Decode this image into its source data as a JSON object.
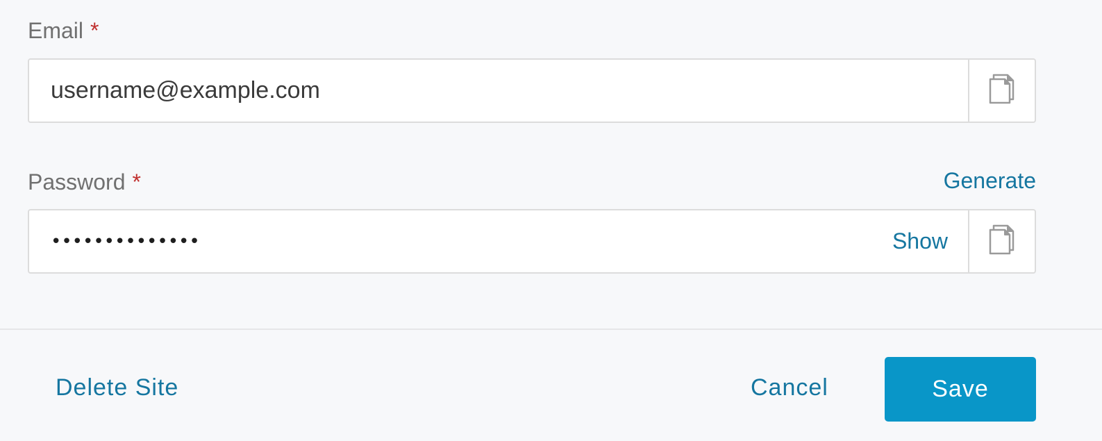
{
  "email": {
    "label": "Email",
    "required_marker": "*",
    "value": "username@example.com",
    "copy_icon": "copy-icon"
  },
  "password": {
    "label": "Password",
    "required_marker": "*",
    "masked_value": "••••••••••••••",
    "show_label": "Show",
    "generate_label": "Generate",
    "copy_icon": "copy-icon"
  },
  "footer": {
    "delete_label": "Delete Site",
    "cancel_label": "Cancel",
    "save_label": "Save"
  },
  "colors": {
    "link": "#1576a0",
    "primary_button": "#0996c8",
    "required": "#c0302f",
    "label": "#707070",
    "background": "#f7f8fa"
  }
}
